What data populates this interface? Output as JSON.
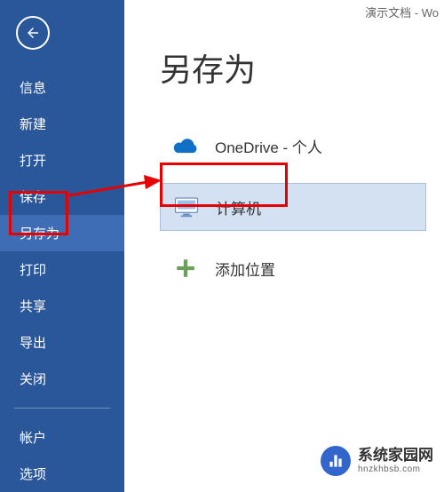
{
  "window_title": "演示文档 - Wo",
  "sidebar": {
    "items": [
      {
        "label": "信息"
      },
      {
        "label": "新建"
      },
      {
        "label": "打开"
      },
      {
        "label": "保存"
      },
      {
        "label": "另存为",
        "selected": true
      },
      {
        "label": "打印"
      },
      {
        "label": "共享"
      },
      {
        "label": "导出"
      },
      {
        "label": "关闭"
      }
    ],
    "bottom_items": [
      {
        "label": "帐户"
      },
      {
        "label": "选项"
      }
    ]
  },
  "page": {
    "title": "另存为",
    "locations": [
      {
        "label": "OneDrive - 个人",
        "icon": "cloud"
      },
      {
        "label": "计算机",
        "icon": "computer",
        "selected": true
      },
      {
        "label": "添加位置",
        "icon": "plus"
      }
    ]
  },
  "watermark": {
    "title": "系统家园网",
    "url": "hnzkhbsb.com"
  }
}
